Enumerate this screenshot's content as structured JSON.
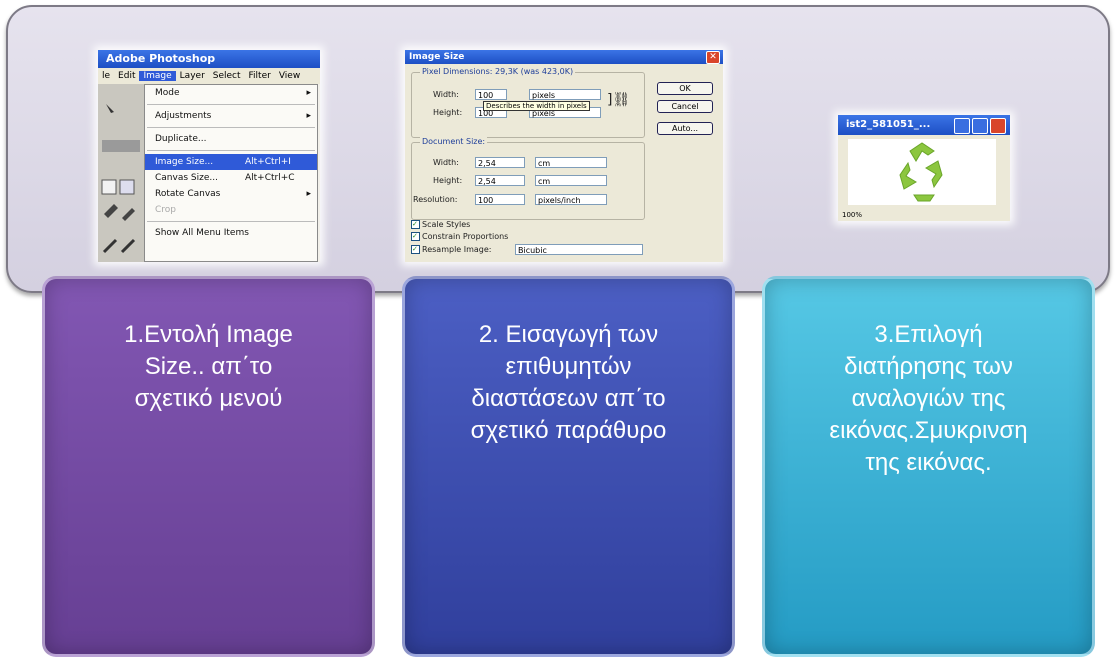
{
  "steps": [
    {
      "text": "1.Εντολή Image\nSize.. απ΄το\nσχετικό μενού",
      "color": "#7350a4"
    },
    {
      "text": "2. Εισαγωγή των\nεπιθυμητών\nδιαστάσεων απ΄το\nσχετικό παράθυρο",
      "color": "#3d4db0"
    },
    {
      "text": "3.Επιλογή\nδιατήρησης των\nαναλογιών της\nεικόνας.Σμυκρινση\nτης εικόνας.",
      "color": "#3cb4d8"
    }
  ],
  "screenshot1": {
    "title": "Adobe Photoshop",
    "menubar": [
      "le",
      "Edit",
      "Image",
      "Layer",
      "Select",
      "Filter",
      "View"
    ],
    "menu_items": {
      "mode": "Mode",
      "adjustments": "Adjustments",
      "duplicate": "Duplicate...",
      "image_size": "Image Size...",
      "image_size_shortcut": "Alt+Ctrl+I",
      "canvas_size": "Canvas Size...",
      "canvas_size_shortcut": "Alt+Ctrl+C",
      "rotate_canvas": "Rotate Canvas",
      "crop": "Crop",
      "show_all": "Show All Menu Items"
    }
  },
  "screenshot2": {
    "title": "Image Size",
    "pixel_dimensions": "Pixel Dimensions: 29,3K (was 423,0K)",
    "width_label": "Width:",
    "width_value": "100",
    "width_unit": "pixels",
    "height_label": "Height:",
    "height_value": "100",
    "height_unit": "pixels",
    "tooltip": "Describes the width in pixels",
    "document_size": "Document Size:",
    "doc_width_label": "Width:",
    "doc_width_value": "2,54",
    "doc_width_unit": "cm",
    "doc_height_label": "Height:",
    "doc_height_value": "2,54",
    "doc_height_unit": "cm",
    "resolution_label": "Resolution:",
    "resolution_value": "100",
    "resolution_unit": "pixels/inch",
    "scale_styles": "Scale Styles",
    "constrain": "Constrain Proportions",
    "resample": "Resample Image:",
    "resample_value": "Bicubic",
    "ok": "OK",
    "cancel": "Cancel",
    "auto": "Auto..."
  },
  "screenshot3": {
    "title": "ist2_581051_...",
    "zoom": "100%"
  }
}
